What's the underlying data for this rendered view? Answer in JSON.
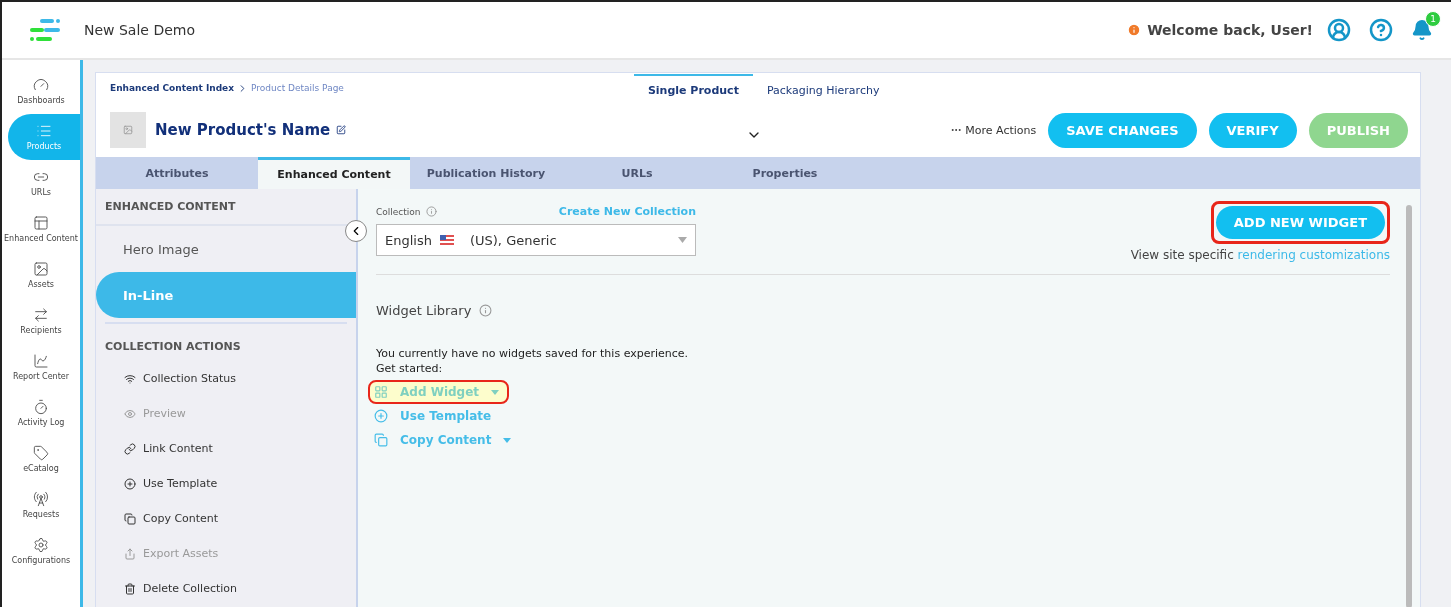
{
  "app": {
    "title": "New Sale Demo",
    "welcome": "Welcome back, User!",
    "notification_count": "1"
  },
  "nav": [
    {
      "label": "Dashboards",
      "selected": false
    },
    {
      "label": "Products",
      "selected": true
    },
    {
      "label": "URLs",
      "selected": false
    },
    {
      "label": "Enhanced Content",
      "selected": false
    },
    {
      "label": "Assets",
      "selected": false
    },
    {
      "label": "Recipients",
      "selected": false
    },
    {
      "label": "Report Center",
      "selected": false
    },
    {
      "label": "Activity Log",
      "selected": false
    },
    {
      "label": "eCatalog",
      "selected": false
    },
    {
      "label": "Requests",
      "selected": false
    },
    {
      "label": "Configurations",
      "selected": false
    }
  ],
  "breadcrumb": [
    "Enhanced Content Index",
    "Product Details Page"
  ],
  "view_tabs": [
    {
      "label": "Single Product",
      "selected": true
    },
    {
      "label": "Packaging Hierarchy",
      "selected": false
    }
  ],
  "product": {
    "name": "New Product's Name"
  },
  "actions": {
    "more": "More Actions",
    "buttons": [
      {
        "label": "SAVE CHANGES",
        "disabled": false
      },
      {
        "label": "VERIFY",
        "disabled": false
      },
      {
        "label": "PUBLISH",
        "disabled": true
      }
    ]
  },
  "tabs": [
    {
      "label": "Attributes",
      "selected": false
    },
    {
      "label": "Enhanced Content",
      "selected": true
    },
    {
      "label": "Publication History",
      "selected": false
    },
    {
      "label": "URLs",
      "selected": false
    },
    {
      "label": "Properties",
      "selected": false
    }
  ],
  "side_panel": {
    "heading": "ENHANCED CONTENT",
    "items": [
      {
        "label": "Hero Image",
        "selected": false
      },
      {
        "label": "In-Line",
        "selected": true
      }
    ],
    "actions_heading": "COLLECTION ACTIONS",
    "actions": [
      {
        "label": "Collection Status",
        "disabled": false
      },
      {
        "label": "Preview",
        "disabled": true
      },
      {
        "label": "Link Content",
        "disabled": false
      },
      {
        "label": "Use Template",
        "disabled": false
      },
      {
        "label": "Copy Content",
        "disabled": false
      },
      {
        "label": "Export Assets",
        "disabled": true
      },
      {
        "label": "Delete Collection",
        "disabled": false
      }
    ]
  },
  "collection": {
    "label": "Collection",
    "create_link": "Create New Collection",
    "value_language": "English",
    "value_rest": "(US), Generic"
  },
  "add_widget_button": {
    "label": "ADD NEW WIDGET",
    "highlighted": true
  },
  "rendering": {
    "text": "View site specific",
    "link": "rendering customizations"
  },
  "widget_library": {
    "title": "Widget Library",
    "message": "You currently have no widgets saved for this experience.",
    "prompt": "Get started:",
    "options": [
      {
        "label": "Add Widget",
        "has_menu": true,
        "highlighted": true
      },
      {
        "label": "Use Template",
        "has_menu": false,
        "highlighted": false
      },
      {
        "label": "Copy Content",
        "has_menu": true,
        "highlighted": false
      }
    ]
  }
}
